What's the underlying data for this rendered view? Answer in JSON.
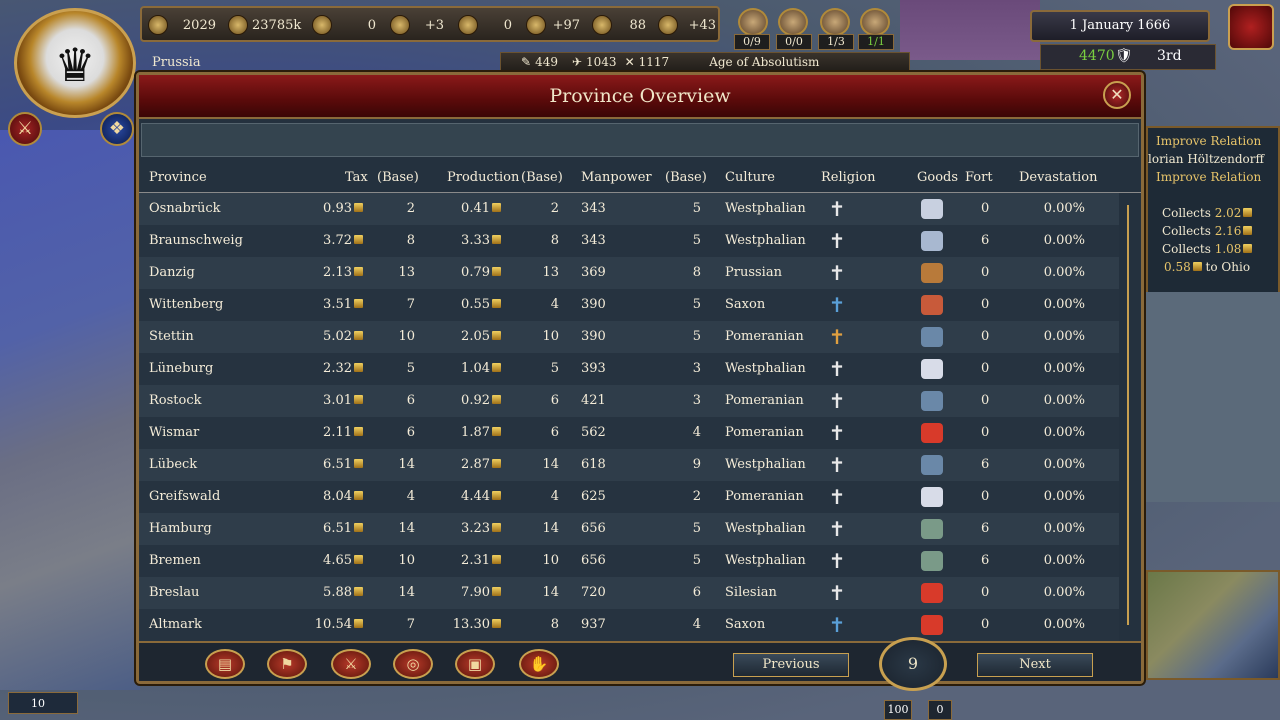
{
  "topbar": {
    "treasury": "2029",
    "manpower": "23785k",
    "sailors": "0",
    "stability": "+3",
    "corruption": "0",
    "prestige": "+97",
    "legitimacy": "88",
    "power_projection": "+43"
  },
  "advisors": [
    "0/9",
    "0/0",
    "1/3",
    "1/1"
  ],
  "country": {
    "name": "Prussia"
  },
  "subbar": {
    "army": "449",
    "navy": "1043",
    "forts": "1117",
    "age": "Age of Absolutism"
  },
  "date": "1 January 1666",
  "score": {
    "value": "4470",
    "rank": "3rd"
  },
  "side_panel": {
    "lines": [
      "Improve Relation",
      "lorian Höltzendorff",
      "Improve Relation"
    ],
    "collects": [
      "2.02",
      "2.16",
      "1.08"
    ],
    "collects_label": "Collects",
    "transfer": {
      "amount": "0.58",
      "to": "to Ohio"
    }
  },
  "window": {
    "title": "Province Overview",
    "headers": {
      "province": "Province",
      "tax": "Tax",
      "tax_base": "(Base)",
      "production": "Production",
      "production_base": "(Base)",
      "manpower": "Manpower",
      "manpower_base": "(Base)",
      "culture": "Culture",
      "religion": "Religion",
      "goods": "Goods",
      "fort": "Fort",
      "devastation": "Devastation"
    },
    "rows": [
      {
        "province": "Osnabrück",
        "tax": "0.93",
        "tax_base": "2",
        "production": "0.41",
        "production_base": "2",
        "manpower": "343",
        "manpower_base": "5",
        "culture": "Westphalian",
        "religion": "catholic",
        "goods": "cloth",
        "fort": "0",
        "devastation": "0.00%"
      },
      {
        "province": "Braunschweig",
        "tax": "3.72",
        "tax_base": "8",
        "production": "3.33",
        "production_base": "8",
        "manpower": "343",
        "manpower_base": "5",
        "culture": "Westphalian",
        "religion": "catholic",
        "goods": "paper",
        "fort": "6",
        "devastation": "0.00%"
      },
      {
        "province": "Danzig",
        "tax": "2.13",
        "tax_base": "13",
        "production": "0.79",
        "production_base": "13",
        "manpower": "369",
        "manpower_base": "8",
        "culture": "Prussian",
        "religion": "catholic",
        "goods": "naval-supplies",
        "fort": "0",
        "devastation": "0.00%"
      },
      {
        "province": "Wittenberg",
        "tax": "3.51",
        "tax_base": "7",
        "production": "0.55",
        "production_base": "4",
        "manpower": "390",
        "manpower_base": "5",
        "culture": "Saxon",
        "religion": "protestant",
        "goods": "copper",
        "fort": "0",
        "devastation": "0.00%"
      },
      {
        "province": "Stettin",
        "tax": "5.02",
        "tax_base": "10",
        "production": "2.05",
        "production_base": "10",
        "manpower": "390",
        "manpower_base": "5",
        "culture": "Pomeranian",
        "religion": "reformed",
        "goods": "fish",
        "fort": "0",
        "devastation": "0.00%"
      },
      {
        "province": "Lüneburg",
        "tax": "2.32",
        "tax_base": "5",
        "production": "1.04",
        "production_base": "5",
        "manpower": "393",
        "manpower_base": "3",
        "culture": "Westphalian",
        "religion": "catholic",
        "goods": "salt",
        "fort": "0",
        "devastation": "0.00%"
      },
      {
        "province": "Rostock",
        "tax": "3.01",
        "tax_base": "6",
        "production": "0.92",
        "production_base": "6",
        "manpower": "421",
        "manpower_base": "3",
        "culture": "Pomeranian",
        "religion": "catholic",
        "goods": "fish",
        "fort": "0",
        "devastation": "0.00%"
      },
      {
        "province": "Wismar",
        "tax": "2.11",
        "tax_base": "6",
        "production": "1.87",
        "production_base": "6",
        "manpower": "562",
        "manpower_base": "4",
        "culture": "Pomeranian",
        "religion": "catholic",
        "goods": "cloth-red",
        "fort": "0",
        "devastation": "0.00%"
      },
      {
        "province": "Lübeck",
        "tax": "6.51",
        "tax_base": "14",
        "production": "2.87",
        "production_base": "14",
        "manpower": "618",
        "manpower_base": "9",
        "culture": "Westphalian",
        "religion": "catholic",
        "goods": "fish",
        "fort": "6",
        "devastation": "0.00%"
      },
      {
        "province": "Greifswald",
        "tax": "8.04",
        "tax_base": "4",
        "production": "4.44",
        "production_base": "4",
        "manpower": "625",
        "manpower_base": "2",
        "culture": "Pomeranian",
        "religion": "catholic",
        "goods": "salt",
        "fort": "0",
        "devastation": "0.00%"
      },
      {
        "province": "Hamburg",
        "tax": "6.51",
        "tax_base": "14",
        "production": "3.23",
        "production_base": "14",
        "manpower": "656",
        "manpower_base": "5",
        "culture": "Westphalian",
        "religion": "catholic",
        "goods": "fish-green",
        "fort": "6",
        "devastation": "0.00%"
      },
      {
        "province": "Bremen",
        "tax": "4.65",
        "tax_base": "10",
        "production": "2.31",
        "production_base": "10",
        "manpower": "656",
        "manpower_base": "5",
        "culture": "Westphalian",
        "religion": "catholic",
        "goods": "fish-green",
        "fort": "6",
        "devastation": "0.00%"
      },
      {
        "province": "Breslau",
        "tax": "5.88",
        "tax_base": "14",
        "production": "7.90",
        "production_base": "14",
        "manpower": "720",
        "manpower_base": "6",
        "culture": "Silesian",
        "religion": "catholic",
        "goods": "cloth-red",
        "fort": "0",
        "devastation": "0.00%"
      },
      {
        "province": "Altmark",
        "tax": "10.54",
        "tax_base": "7",
        "production": "13.30",
        "production_base": "8",
        "manpower": "937",
        "manpower_base": "4",
        "culture": "Saxon",
        "religion": "protestant",
        "goods": "cloth-red",
        "fort": "0",
        "devastation": "0.00%"
      }
    ],
    "footer": {
      "previous": "Previous",
      "next": "Next",
      "page": "9"
    }
  },
  "bottom_left": {
    "value": "10"
  },
  "bottom_counts": [
    "100",
    "0"
  ],
  "colors": {
    "accent_gold": "#c8a050",
    "title_red": "#8a1a1a",
    "positive_green": "#7ad040"
  }
}
